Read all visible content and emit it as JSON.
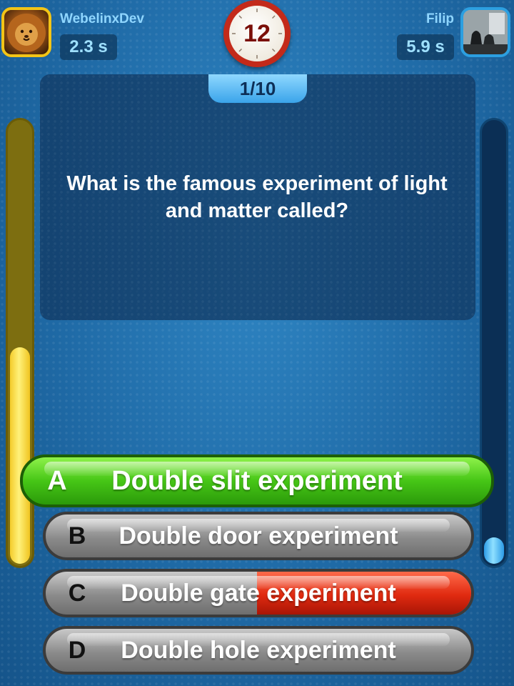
{
  "player_left": {
    "name": "WebelinxDev",
    "time": "2.3 s",
    "avatar_icon": "lion-avatar-icon",
    "bar_level": 0.49
  },
  "player_right": {
    "name": "Filip",
    "time": "5.9 s",
    "avatar_icon": "photo-avatar-icon",
    "bar_level": 0.06
  },
  "timer": {
    "value": "12"
  },
  "question": {
    "counter": "1/10",
    "text": "What is the famous experiment of light and matter called?"
  },
  "answers": [
    {
      "letter": "A",
      "label": "Double slit experiment",
      "state": "correct",
      "color": "#46c616"
    },
    {
      "letter": "B",
      "label": "Double door experiment",
      "state": "neutral",
      "color": "#8b8b8b"
    },
    {
      "letter": "C",
      "label": "Double gate experiment",
      "state": "opponent-wrong",
      "color": "#e02a10"
    },
    {
      "letter": "D",
      "label": "Double hole experiment",
      "state": "neutral",
      "color": "#8b8b8b"
    }
  ],
  "colors": {
    "left_bar": "#f4cc2a",
    "right_bar": "#2c9be6",
    "background": "#1f6aa6"
  }
}
